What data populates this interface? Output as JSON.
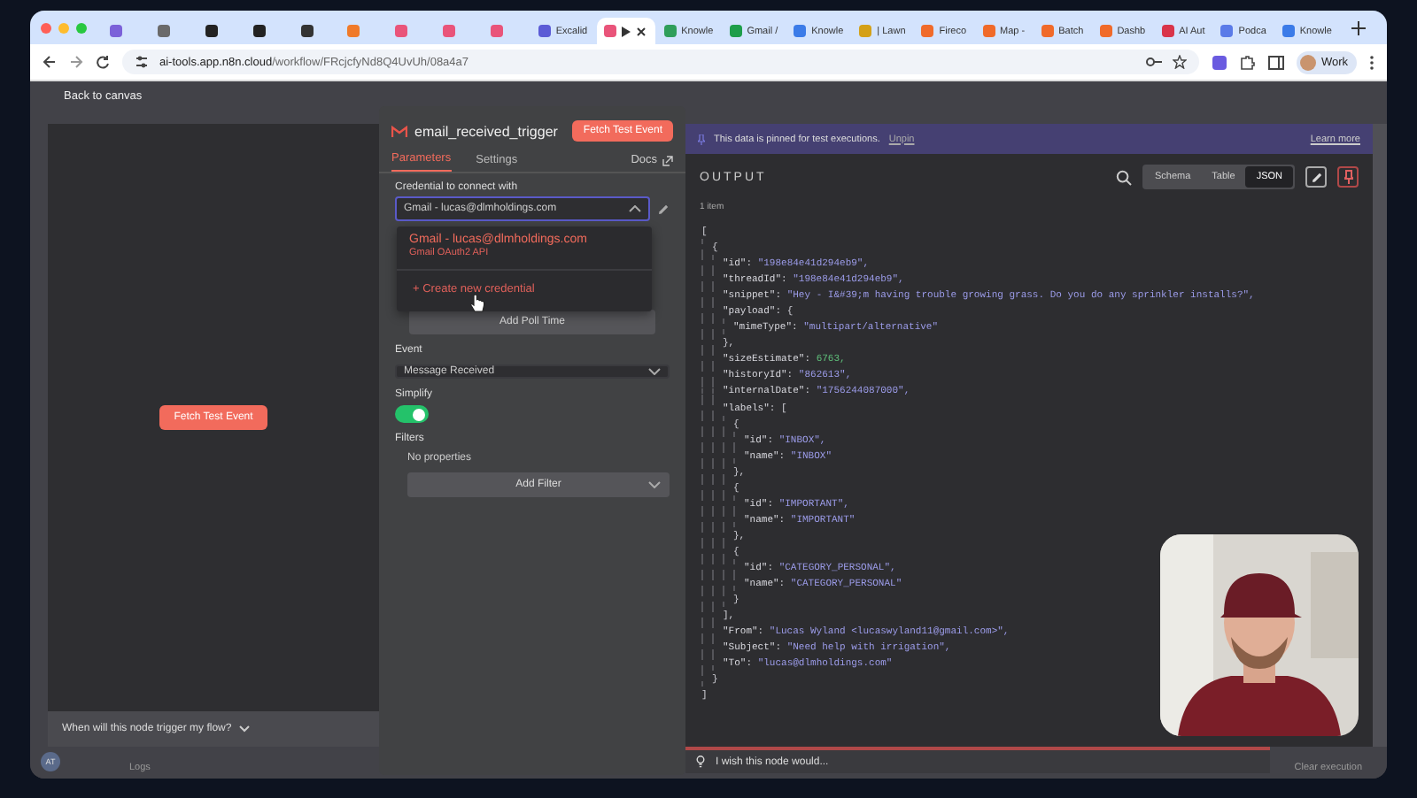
{
  "browser": {
    "tabs": [
      {
        "color": "#7b61d9",
        "selected": false
      },
      {
        "color": "#6a6a6a",
        "selected": false
      },
      {
        "color": "#222222",
        "selected": false
      },
      {
        "color": "#222222",
        "selected": false
      },
      {
        "color": "#333333",
        "selected": false
      },
      {
        "color": "#f07a2a",
        "selected": false
      },
      {
        "color": "#e9547a",
        "selected": false
      },
      {
        "color": "#e9547a",
        "selected": false
      },
      {
        "color": "#e9547a",
        "selected": false
      },
      {
        "color": "#5b5bd6",
        "label": "Excalid",
        "selected": false
      },
      {
        "color": "#e9547a",
        "selected": true
      },
      {
        "color": "#2f9e5a",
        "label": "Knowle",
        "selected": false
      },
      {
        "color": "#1e9e4a",
        "label": "Gmail /",
        "selected": false
      },
      {
        "color": "#3b7be8",
        "label": "Knowle",
        "selected": false
      },
      {
        "color": "#d4a017",
        "label": "| Lawn",
        "selected": false
      },
      {
        "color": "#f06a2a",
        "label": "Fireco",
        "selected": false
      },
      {
        "color": "#f06a2a",
        "label": "Map -",
        "selected": false
      },
      {
        "color": "#f06a2a",
        "label": "Batch",
        "selected": false
      },
      {
        "color": "#f06a2a",
        "label": "Dashb",
        "selected": false
      },
      {
        "color": "#d9344a",
        "label": "AI Aut",
        "selected": false
      },
      {
        "color": "#5b7be8",
        "label": "Podca",
        "selected": false
      },
      {
        "color": "#3b7be8",
        "label": "Knowle",
        "selected": false
      }
    ],
    "url_host": "ai-tools.app.n8n.cloud",
    "url_path": "/workflow/FRcjcfyNd8Q4UvUh/08a4a7",
    "profile": "Work"
  },
  "back_link": "Back to canvas",
  "input_panel": {
    "fetch_button": "Fetch Test Event",
    "footer": "When will this node trigger my flow?"
  },
  "node": {
    "title": "email_received_trigger",
    "fetch_button": "Fetch Test Event",
    "tabs": [
      {
        "label": "Parameters",
        "selected": true
      },
      {
        "label": "Settings",
        "selected": false
      }
    ],
    "docs": "Docs",
    "credential_label": "Credential to connect with",
    "credential_value": "Gmail - lucas@dlmholdings.com",
    "credential_menu": {
      "option_title": "Gmail - lucas@dlmholdings.com",
      "option_subtitle": "Gmail OAuth2 API",
      "create": "+ Create new credential"
    },
    "poll_button": "Add Poll Time",
    "event_label": "Event",
    "event_value": "Message Received",
    "simplify_label": "Simplify",
    "simplify_on": true,
    "filters_label": "Filters",
    "no_properties": "No properties",
    "filter_button": "Add Filter"
  },
  "output": {
    "banner": "This data is pinned for test executions.",
    "unpin": "Unpin",
    "learn_more": "Learn more",
    "title": "OUTPUT",
    "views": [
      {
        "label": "Schema",
        "selected": false
      },
      {
        "label": "Table",
        "selected": false
      },
      {
        "label": "JSON",
        "selected": true
      }
    ],
    "count": "1 item",
    "json": [
      {
        "value": "[",
        "kind": "open",
        "close": "]",
        "children": [
          {
            "value": "{",
            "kind": "open",
            "close": "}",
            "children": [
              {
                "key": "\"id\": ",
                "value": "\"198e84e41d294eb9\",",
                "kind": "string"
              },
              {
                "key": "\"threadId\": ",
                "value": "\"198e84e41d294eb9\",",
                "kind": "string"
              },
              {
                "key": "\"snippet\": ",
                "value": "\"Hey - I&#39;m having trouble growing grass. Do you do any sprinkler installs?\",",
                "kind": "string"
              },
              {
                "key": "\"payload\": ",
                "value": "{",
                "kind": "open",
                "close": "},",
                "children": [
                  {
                    "key": "\"mimeType\": ",
                    "value": "\"multipart/alternative\"",
                    "kind": "string"
                  }
                ]
              },
              {
                "key": "\"sizeEstimate\": ",
                "value": "6763,",
                "kind": "number"
              },
              {
                "key": "\"historyId\": ",
                "value": "\"862613\",",
                "kind": "string"
              },
              {
                "key": "\"internalDate\": ",
                "value": "\"1756244087000\",",
                "kind": "string"
              },
              {
                "key": "\"labels\": ",
                "value": "[",
                "kind": "open",
                "close": "],",
                "children": [
                  {
                    "value": "{",
                    "kind": "open",
                    "close": "},",
                    "children": [
                      {
                        "key": "\"id\": ",
                        "value": "\"INBOX\",",
                        "kind": "string"
                      },
                      {
                        "key": "\"name\": ",
                        "value": "\"INBOX\"",
                        "kind": "string"
                      }
                    ]
                  },
                  {
                    "value": "{",
                    "kind": "open",
                    "close": "},",
                    "children": [
                      {
                        "key": "\"id\": ",
                        "value": "\"IMPORTANT\",",
                        "kind": "string"
                      },
                      {
                        "key": "\"name\": ",
                        "value": "\"IMPORTANT\"",
                        "kind": "string"
                      }
                    ]
                  },
                  {
                    "value": "{",
                    "kind": "open",
                    "close": "}",
                    "children": [
                      {
                        "key": "\"id\": ",
                        "value": "\"CATEGORY_PERSONAL\",",
                        "kind": "string"
                      },
                      {
                        "key": "\"name\": ",
                        "value": "\"CATEGORY_PERSONAL\"",
                        "kind": "string"
                      }
                    ]
                  }
                ]
              },
              {
                "key": "\"From\": ",
                "value": "\"Lucas Wyland <lucaswyland11@gmail.com>\",",
                "kind": "string"
              },
              {
                "key": "\"Subject\": ",
                "value": "\"Need help with irrigation\",",
                "kind": "string"
              },
              {
                "key": "\"To\": ",
                "value": "\"lucas@dlmholdings.com\"",
                "kind": "string"
              }
            ]
          }
        ]
      }
    ]
  },
  "logs": {
    "label": "Logs",
    "avatar": "AT",
    "feedback": "I wish this node would...",
    "clear": "Clear execution"
  }
}
